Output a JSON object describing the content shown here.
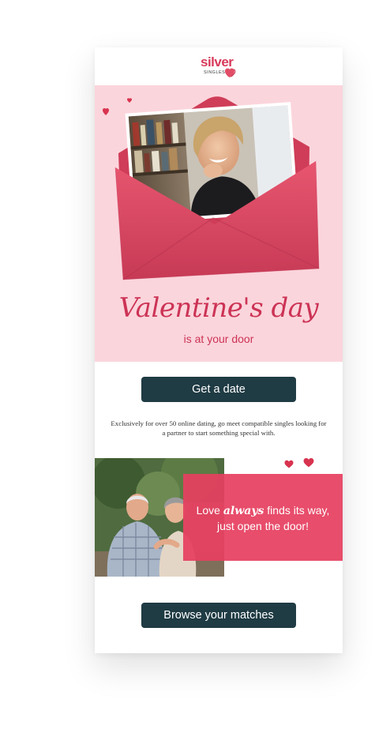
{
  "brand": {
    "name": "silver",
    "tagline": "SINGLES",
    "accent_color": "#d83a5a"
  },
  "hero": {
    "title": "Valentine's day",
    "subtitle": "is at your door",
    "background_color": "#fbd5dc",
    "envelope_color": "#e14d66"
  },
  "cta_primary": {
    "label": "Get a date",
    "color": "#1f3b44"
  },
  "description": "Exclusively for over 50 online dating, go meet compatible singles looking for a partner to start something special with.",
  "promo": {
    "text_before": "Love ",
    "text_emphasis": "always",
    "text_after": " finds its way,",
    "text_line2": "just open the door!",
    "box_color": "#e64060"
  },
  "cta_secondary": {
    "label": "Browse your matches",
    "color": "#1f3b44"
  },
  "icons": [
    "heart-icon",
    "envelope-illustration",
    "woman-photo",
    "couple-photo"
  ]
}
